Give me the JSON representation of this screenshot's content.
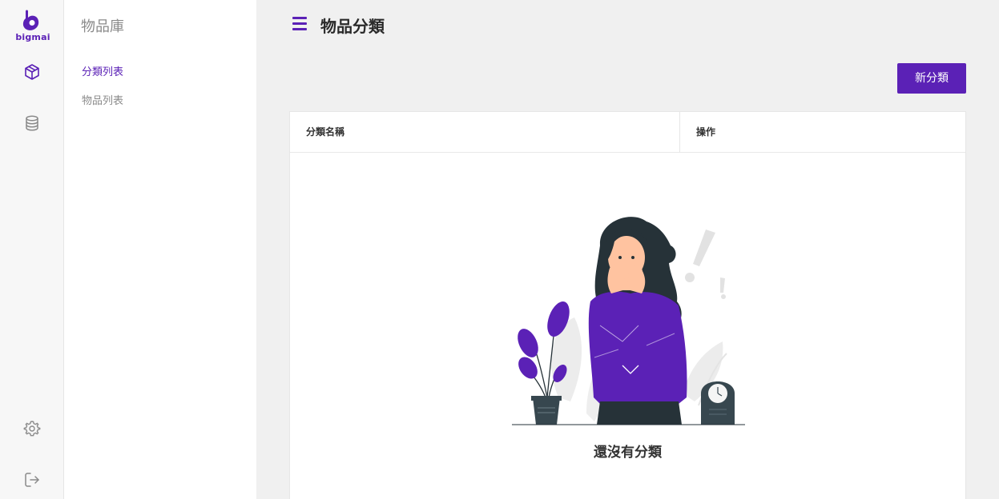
{
  "brand": {
    "name": "bigmai",
    "color": "#5b21b6"
  },
  "rail": {
    "items": [
      {
        "icon": "box-icon",
        "active": true
      },
      {
        "icon": "database-icon",
        "active": false
      }
    ],
    "bottom": [
      {
        "icon": "gear-icon"
      },
      {
        "icon": "logout-icon"
      }
    ]
  },
  "sidenav": {
    "title": "物品庫",
    "items": [
      {
        "label": "分類列表",
        "active": true
      },
      {
        "label": "物品列表",
        "active": false
      }
    ]
  },
  "header": {
    "title": "物品分類"
  },
  "toolbar": {
    "new_label": "新分類"
  },
  "table": {
    "columns": [
      "分類名稱",
      "操作"
    ],
    "rows": [],
    "empty_text": "還沒有分類"
  }
}
